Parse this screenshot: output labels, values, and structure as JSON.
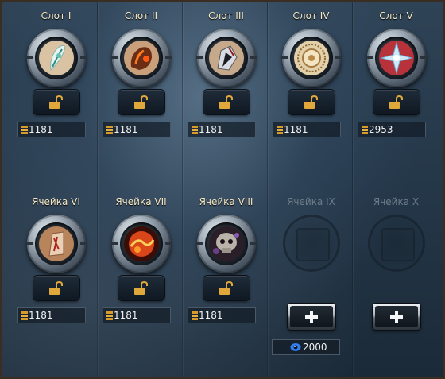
{
  "slots": [
    {
      "title": "Слот I",
      "price": "1181",
      "gem": "crystal-quill",
      "state": "locked"
    },
    {
      "title": "Слот II",
      "price": "1181",
      "gem": "ember-stone",
      "state": "locked"
    },
    {
      "title": "Слот III",
      "price": "1181",
      "gem": "dark-crystal",
      "state": "locked"
    },
    {
      "title": "Слот IV",
      "price": "1181",
      "gem": "sun-seal",
      "state": "locked"
    },
    {
      "title": "Слот V",
      "price": "2953",
      "gem": "frost-star",
      "state": "locked"
    },
    {
      "title": "Ячейка VI",
      "price": "1181",
      "gem": "rune-shard",
      "state": "locked"
    },
    {
      "title": "Ячейка VII",
      "price": "1181",
      "gem": "lava-orb",
      "state": "locked"
    },
    {
      "title": "Ячейка VIII",
      "price": "1181",
      "gem": "skull-gem",
      "state": "locked"
    },
    {
      "title": "Ячейка IX",
      "price": "2000",
      "gem": "",
      "state": "unavailable"
    },
    {
      "title": "Ячейка X",
      "price": "",
      "gem": "",
      "state": "unavailable"
    }
  ],
  "icons": {
    "currency": "gold-coins-icon",
    "lock": "open-padlock-icon",
    "add": "plus-icon",
    "eye_currency": "blue-eye-icon"
  },
  "colors": {
    "title": "#f3e6c4",
    "title_disabled": "#6d7c8a",
    "lock_icon": "#e0a73a",
    "gold": "#d79a2b",
    "eye": "#2f7ff0"
  }
}
